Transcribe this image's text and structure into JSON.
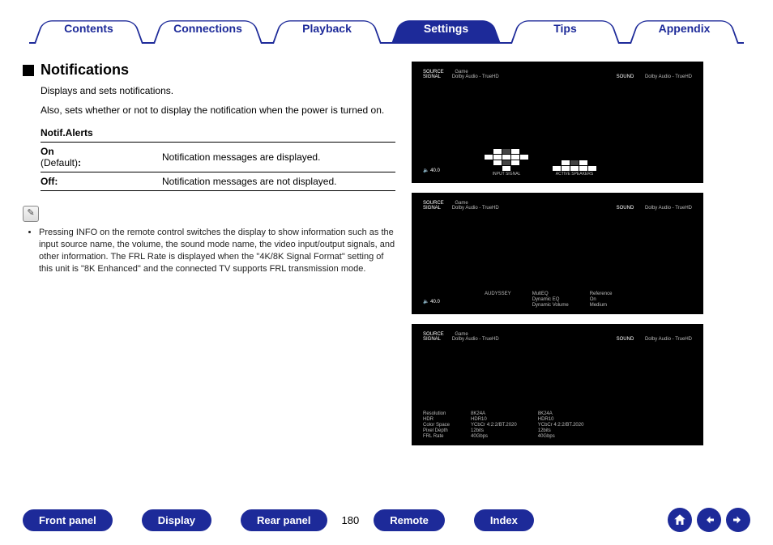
{
  "tabs": {
    "contents": "Contents",
    "connections": "Connections",
    "playback": "Playback",
    "settings": "Settings",
    "tips": "Tips",
    "appendix": "Appendix"
  },
  "section": {
    "title": "Notifications",
    "p1": "Displays and sets notifications.",
    "p2": "Also, sets whether or not to display the notification when the power is turned on.",
    "sub": "Notif.Alerts",
    "rows": {
      "on_label": "On",
      "on_default": "(Default)",
      "on_colon": ":",
      "on_desc": "Notification messages are displayed.",
      "off_label": "Off:",
      "off_desc": "Notification messages are not displayed."
    },
    "note": "Pressing INFO on the remote control switches the display to show information such as the input source name, the volume, the sound mode name, the video input/output signals, and other information. The FRL Rate is displayed when the \"4K/8K Signal Format\" setting of this unit is \"8K Enhanced\" and the connected TV supports FRL transmission mode."
  },
  "shots": {
    "source_lbl": "SOURCE",
    "source_val": "Game",
    "signal_lbl": "SIGNAL",
    "signal_val": "Dolby Audio - TrueHD",
    "sound_lbl": "SOUND",
    "sound_val": "Dolby Audio - TrueHD",
    "volume": "40.0",
    "s1": {
      "input_cap": "INPUT SIGNAL",
      "active_cap": "ACTIVE SPEAKERS"
    },
    "s2": {
      "aud_lbl": "AUDYSSEY",
      "l1": "MultEQ",
      "l2": "Dynamic EQ",
      "l3": "Dynamic Volume",
      "r1": "Reference",
      "r2": "On",
      "r3": "Medium"
    },
    "s3": {
      "c1": {
        "a": "Resolution",
        "b": "HDR",
        "c": "Color Space",
        "d": "Pixel Depth",
        "e": "FRL Rate"
      },
      "c2": {
        "a": "8K24A",
        "b": "HDR10",
        "c": "YCbCr 4:2:2/BT.2020",
        "d": "12bits",
        "e": "40Gbps"
      },
      "c3": {
        "a": "8K24A",
        "b": "HDR10",
        "c": "YCbCr 4:2:2/BT.2020",
        "d": "12bits",
        "e": "40Gbps"
      }
    }
  },
  "footer": {
    "front": "Front panel",
    "display": "Display",
    "rear": "Rear panel",
    "page": "180",
    "remote": "Remote",
    "index": "Index"
  }
}
